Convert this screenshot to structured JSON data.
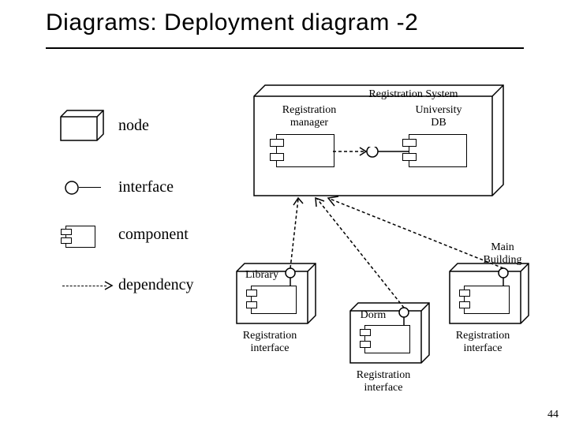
{
  "title": "Diagrams: Deployment diagram -2",
  "legend": {
    "node": "node",
    "interface": "interface",
    "component": "component",
    "dependency": "dependency"
  },
  "nodes": {
    "registration_system": {
      "title": "Registration System",
      "components": {
        "registration_manager": "Registration\nmanager",
        "university_db": "University\nDB"
      }
    },
    "library": {
      "title": "Library",
      "bottom_label": "Registration\ninterface"
    },
    "dorm": {
      "title": "Dorm",
      "bottom_label": "Registration\ninterface"
    },
    "main_building": {
      "title": "Main\nBuilding",
      "bottom_label": "Registration\ninterface"
    }
  },
  "page_number": "44"
}
